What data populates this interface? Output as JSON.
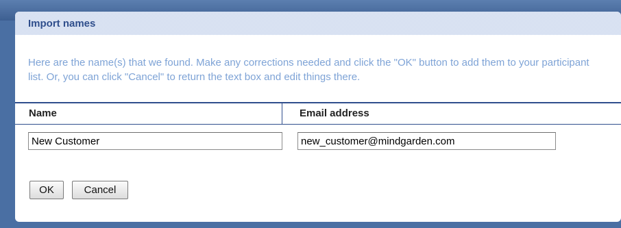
{
  "dialog": {
    "title": "Import names",
    "intro": "Here are the name(s) that we found. Make any corrections needed and click the \"OK\" button to add them to your participant list. Or, you can click \"Cancel\" to return the text box and edit things there."
  },
  "table": {
    "columns": [
      "Name",
      "Email address"
    ],
    "rows": [
      {
        "name": "New Customer",
        "email": "new_customer@mindgarden.com"
      }
    ]
  },
  "buttons": {
    "ok": "OK",
    "cancel": "Cancel"
  },
  "colors": {
    "title": "#2f4e8c",
    "intro_text": "#7ea3d6",
    "titlebar_bg": "#cdd9ee",
    "page_bg": "#4a6fa3"
  }
}
